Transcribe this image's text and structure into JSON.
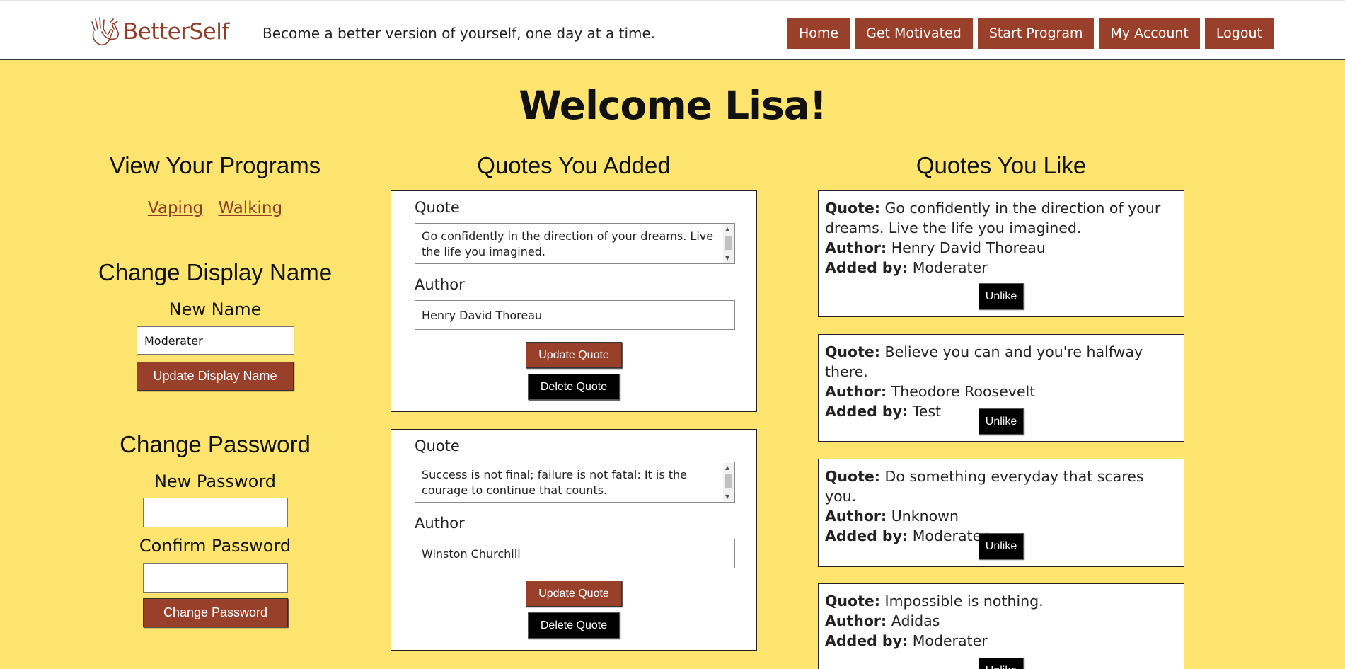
{
  "header": {
    "brand": "BetterSelf",
    "tagline": "Become a better version of yourself, one day at a time.",
    "nav": [
      "Home",
      "Get Motivated",
      "Start Program",
      "My Account",
      "Logout"
    ]
  },
  "welcome": "Welcome Lisa!",
  "programs": {
    "title": "View Your Programs",
    "links": [
      "Vaping",
      "Walking"
    ]
  },
  "display_name": {
    "title": "Change Display Name",
    "label": "New Name",
    "value": "Moderater",
    "button": "Update Display Name"
  },
  "password": {
    "title": "Change Password",
    "new_label": "New Password",
    "confirm_label": "Confirm Password",
    "button": "Change Password"
  },
  "added": {
    "title": "Quotes You Added",
    "quote_label": "Quote",
    "author_label": "Author",
    "update_label": "Update Quote",
    "delete_label": "Delete Quote",
    "items": [
      {
        "quote": "Go confidently in the direction of your dreams. Live the life you imagined.",
        "author": "Henry David Thoreau"
      },
      {
        "quote": "Success is not final; failure is not fatal: It is the courage to continue that counts.",
        "author": "Winston Churchill"
      }
    ]
  },
  "liked": {
    "title": "Quotes You Like",
    "quote_key": "Quote:",
    "author_key": "Author:",
    "added_key": "Added by:",
    "unlike_label": "Unlike",
    "items": [
      {
        "quote": "Go confidently in the direction of your dreams. Live the life you imagined.",
        "author": "Henry David Thoreau",
        "added_by": "Moderater"
      },
      {
        "quote": "Believe you can and you're halfway there.",
        "author": "Theodore Roosevelt",
        "added_by": "Test"
      },
      {
        "quote": "Do something everyday that scares you.",
        "author": "Unknown",
        "added_by": "Moderater"
      },
      {
        "quote": "Impossible is nothing.",
        "author": "Adidas",
        "added_by": "Moderater"
      }
    ]
  }
}
